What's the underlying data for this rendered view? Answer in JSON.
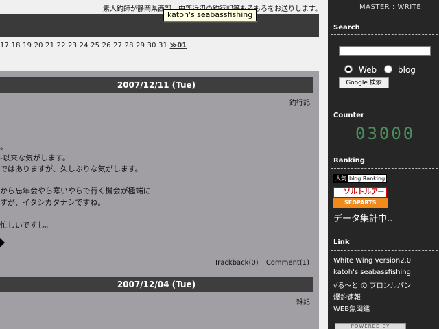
{
  "header": {
    "tagline": "素人釣師が静岡県西部、中部近辺の釣行記等もろもろをお送りします。",
    "tooltip": "katoh's seabassfishing"
  },
  "calendar": {
    "days": "17 18 19 20 21 22 23 24 25 26 27 28 29 30 31 ",
    "next": "≫01"
  },
  "entries": [
    {
      "date": "2007/12/11 (Tue)",
      "category": "釣行記",
      "lines": [
        "。",
        "-以来な気がします。",
        "ではありますが、久しぶりな気がします。",
        "から忘年会やら寒いやらで行く機会が極端に",
        "すが、イタシカタナシですね。",
        "忙しいですし。"
      ],
      "trackback": "Trackback(0)",
      "comment": "Comment(1)"
    },
    {
      "date": "2007/12/04 (Tue)",
      "category": "雑記"
    }
  ],
  "sidebar": {
    "master": "MASTER",
    "separator": ":",
    "write": "WRITE",
    "search": {
      "title": "Search",
      "value": "",
      "options": [
        "Web",
        "blog"
      ],
      "selected": "Web",
      "button": "Google 検索"
    },
    "counter": {
      "title": "Counter",
      "value": "03000"
    },
    "ranking": {
      "title": "Ranking",
      "badge_ninki_a": "人気",
      "badge_ninki_b": "blog Ranking",
      "badge_salt": "ソルトルアー",
      "badge_seo": "SEOPARTS",
      "status": "データ集計中.."
    },
    "links": {
      "title": "Link",
      "items": [
        "White Wing version2.0",
        "katoh's seabassfishing",
        "√る～と の ブロンルパン",
        "爆釣速報",
        "WEB魚図鑑"
      ]
    },
    "powered": "POWERED BY"
  },
  "colors": {
    "sidebar_bg": "#262626",
    "content_bg": "#a19fa3",
    "header_bar": "#3e3e3e",
    "counter": "#4a8f5c"
  }
}
